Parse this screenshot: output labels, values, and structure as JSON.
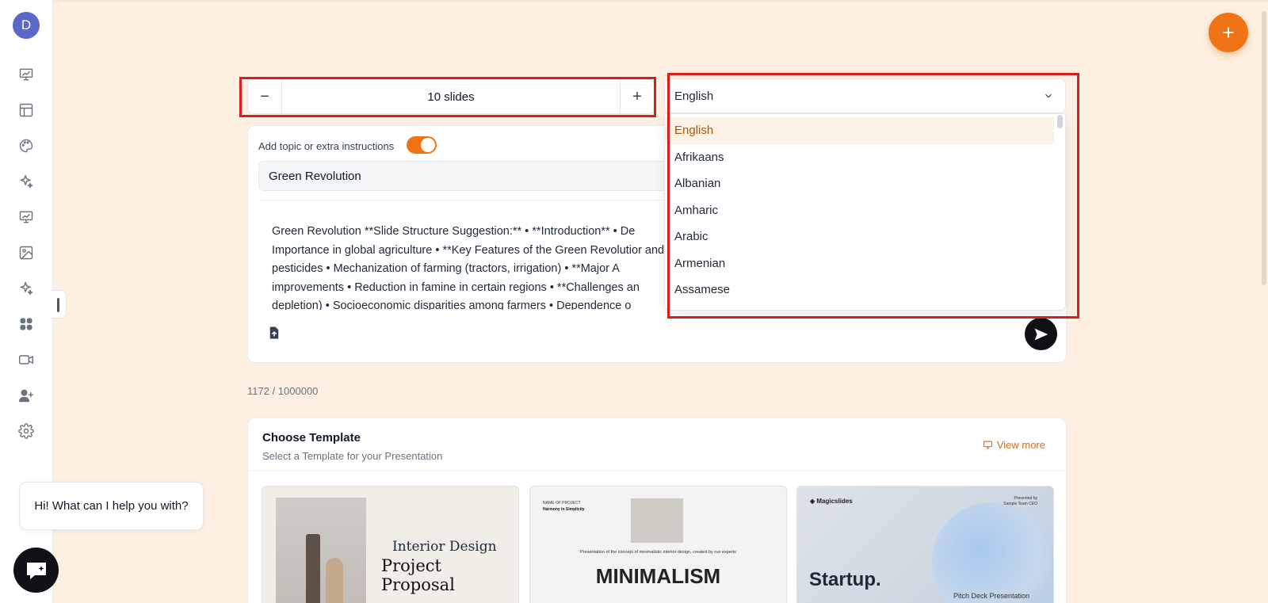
{
  "user": {
    "avatar_initial": "D"
  },
  "sidebar": {
    "icons": [
      "presentation-chart-icon",
      "layout-icon",
      "palette-icon",
      "sparkle-icon",
      "chart-board-icon",
      "image-icon",
      "magic-sparkle-icon",
      "apps-grid-icon",
      "video-icon",
      "add-user-icon",
      "settings-icon"
    ]
  },
  "slides": {
    "count_label": "10 slides",
    "minus": "−",
    "plus": "+"
  },
  "language": {
    "selected": "English",
    "options": [
      "English",
      "Afrikaans",
      "Albanian",
      "Amharic",
      "Arabic",
      "Armenian",
      "Assamese"
    ]
  },
  "topic": {
    "label": "Add topic or extra instructions",
    "toggle_on": true,
    "value": "Green Revolution",
    "description": "Green Revolution **Slide Structure Suggestion:** • **Introduction** • De Importance in global agriculture • **Key Features of the Green Revolutior and pesticides • Mechanization of farming (tractors, irrigation) • **Major A improvements • Reduction in famine in certain regions • **Challenges an depletion) • Socioeconomic disparities among farmers • Dependence o"
  },
  "char_count": "1172 / 1000000",
  "templates": {
    "title": "Choose Template",
    "subtitle": "Select a Template for your Presentation",
    "view_more": "View more",
    "t1": {
      "line1": "Interior Design",
      "line2": "Project Proposal"
    },
    "t2": {
      "label": "NAME OF PROJECT",
      "name": "Harmony in Simplicity",
      "caption": "Presentation of the concept of minimalistic interior design, created by our experts",
      "big": "MINIMALISM"
    },
    "t3": {
      "logo": "Magicslides",
      "presented_by": "Presented by",
      "presenter": "Sample Team CEO",
      "big": "Startup.",
      "subtitle": "Pitch Deck Presentation"
    }
  },
  "chat": {
    "greeting": "Hi! What can I help you with?"
  },
  "colors": {
    "accent": "#f07415",
    "highlight": "#d71f1f",
    "background": "#fdf0e2"
  }
}
